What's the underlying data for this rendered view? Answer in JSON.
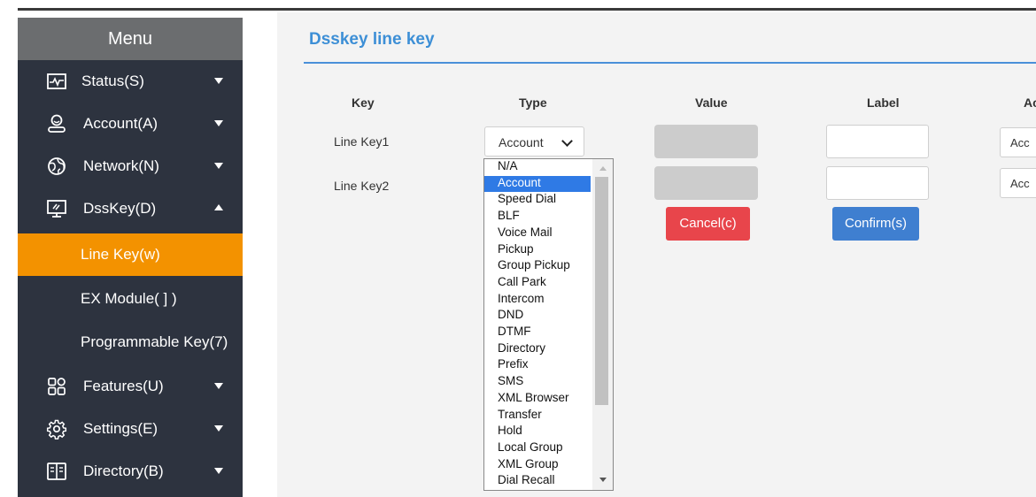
{
  "sidebar": {
    "title": "Menu",
    "items": [
      {
        "label": "Status(S)",
        "icon": "status-pulse-icon"
      },
      {
        "label": "Account(A)",
        "icon": "account-icon"
      },
      {
        "label": "Network(N)",
        "icon": "network-globe-icon"
      },
      {
        "label": "DssKey(D)",
        "icon": "dsskey-monitor-icon",
        "expanded": true
      },
      {
        "label": "Features(U)",
        "icon": "features-grid-icon"
      },
      {
        "label": "Settings(E)",
        "icon": "settings-gear-icon"
      },
      {
        "label": "Directory(B)",
        "icon": "directory-book-icon"
      }
    ],
    "sub_items": [
      {
        "label": "Line Key(w)",
        "active": true
      },
      {
        "label": "EX Module( ] )"
      },
      {
        "label": "Programmable Key(7)"
      }
    ],
    "colors": {
      "background": "#2d333f",
      "active": "#f39200",
      "header": "#6b6d6f"
    }
  },
  "main": {
    "title": "Dsskey line key",
    "columns": [
      "Key",
      "Type",
      "Value",
      "Label",
      "Ac"
    ],
    "rows": [
      {
        "key": "Line Key1",
        "type": "Account",
        "account": "Acc"
      },
      {
        "key": "Line Key2",
        "account": "Acc"
      }
    ],
    "cancel_label": "Cancel(c)",
    "confirm_label": "Confirm(s)",
    "colors": {
      "title": "#3d8fd6",
      "cancel": "#e8454b",
      "confirm": "#3f7fd0"
    }
  },
  "type_dropdown": {
    "selected": "Account",
    "options": [
      "N/A",
      "Account",
      "Speed Dial",
      "BLF",
      "Voice Mail",
      "Pickup",
      "Group Pickup",
      "Call Park",
      "Intercom",
      "DND",
      "DTMF",
      "Directory",
      "Prefix",
      "SMS",
      "XML Browser",
      "Transfer",
      "Hold",
      "Local Group",
      "XML Group",
      "Dial Recall"
    ]
  }
}
